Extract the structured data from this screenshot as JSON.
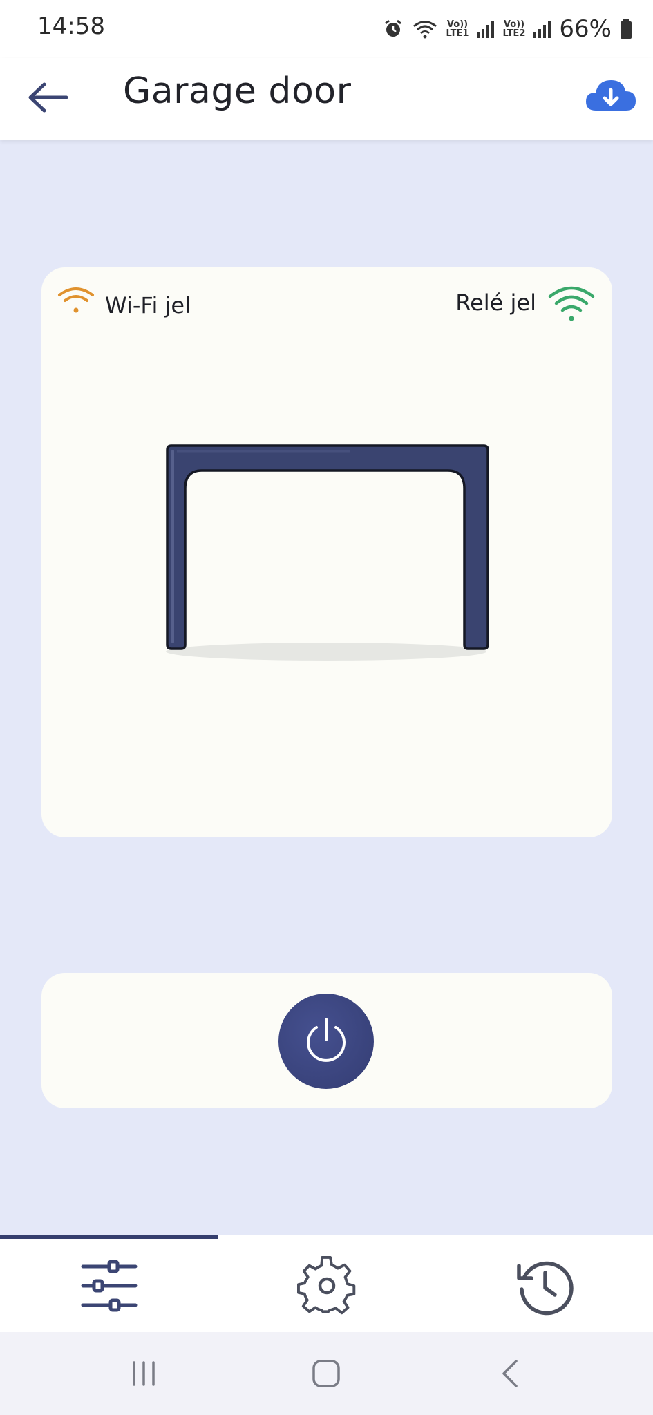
{
  "status_bar": {
    "time": "14:58",
    "sim1_top": "Vo))",
    "sim1_bottom": "LTE1",
    "sim2_top": "Vo))",
    "sim2_bottom": "LTE2",
    "battery": "66%",
    "icons": [
      "alarm-icon",
      "wifi-icon",
      "signal-icon",
      "signal-icon",
      "battery-icon"
    ]
  },
  "app_bar": {
    "title": "Garage door",
    "back_icon": "arrow-left-icon",
    "action_icon": "cloud-download-icon",
    "accent": "#3a6fe0"
  },
  "door_card": {
    "wifi_label": "Wi-Fi jel",
    "relay_label": "Relé jel",
    "wifi_color": "#e0922e",
    "relay_color": "#3aa86a",
    "door_color": "#3a4470",
    "door_state_icon": "garage-door-open-icon"
  },
  "control": {
    "power_icon": "power-icon",
    "button_color": "#3d477f"
  },
  "bottom_nav": {
    "tabs": [
      {
        "icon": "sliders-icon",
        "active": true
      },
      {
        "icon": "gear-icon",
        "active": false
      },
      {
        "icon": "history-icon",
        "active": false
      }
    ],
    "indicator_color": "#353e6e"
  },
  "system_nav": {
    "buttons": [
      "recents-icon",
      "home-icon",
      "back-icon"
    ]
  }
}
